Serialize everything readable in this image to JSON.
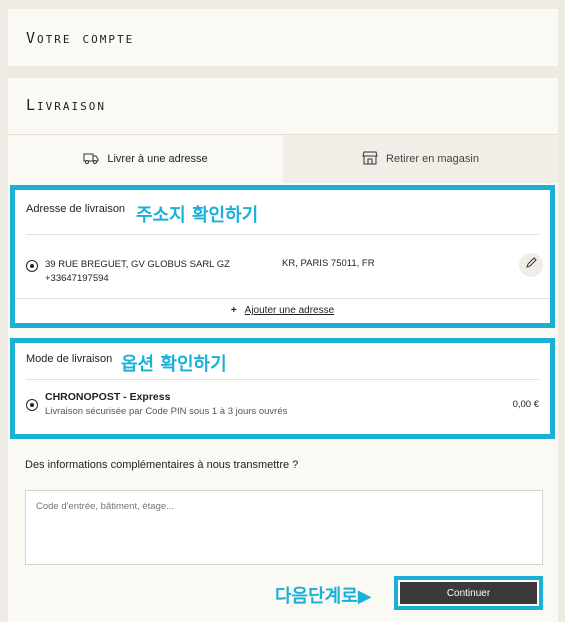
{
  "account": {
    "title": "Votre compte"
  },
  "delivery": {
    "title": "Livraison",
    "tabs": [
      {
        "label": "Livrer à une adresse",
        "icon": "truck-icon",
        "active": true
      },
      {
        "label": "Retirer en magasin",
        "icon": "store-icon",
        "active": false
      }
    ],
    "address": {
      "label": "Adresse de livraison",
      "callout": "주소지 확인하기",
      "line1": "39 RUE BREGUET, GV GLOBUS SARL GZ",
      "city": "KR, PARIS 75011, FR",
      "phone": "+33647197594",
      "add_link": "Ajouter une adresse",
      "add_symbol": "+"
    },
    "mode": {
      "label": "Mode de livraison",
      "callout": "옵션 확인하기",
      "name": "CHRONOPOST - Express",
      "description": "Livraison sécurisée par Code PIN sous 1 à 3 jours ouvrés",
      "price": "0,00 €"
    },
    "extra_info": {
      "label": "Des informations complémentaires à nous transmettre ?",
      "placeholder": "Code d'entrée, bâtiment, étage..."
    },
    "next_callout": "다음단계로▶",
    "continue_label": "Continuer"
  },
  "colors": {
    "highlight": "#1ab0d8",
    "button": "#3a3a3a",
    "background": "#eeebe5"
  }
}
